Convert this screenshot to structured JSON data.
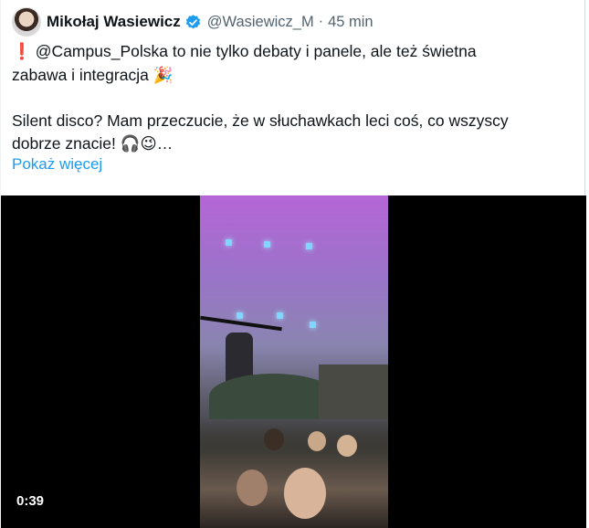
{
  "tweet": {
    "author_name": "Mikołaj Wasiewicz",
    "handle": "@Wasiewicz_M",
    "separator": "·",
    "time": "45 min",
    "line1_mention": "@Campus_Polska",
    "line1_rest": " to nie tylko debaty i panele, ale też świetna",
    "line2": "zabawa i integracja 🎉",
    "line3": "Silent disco? Mam przeczucie, że w słuchawkach leci coś, co wszyscy",
    "line4": "dobrze znacie! 🎧😉…",
    "show_more": "Pokaż więcej"
  },
  "video": {
    "duration": "0:39"
  },
  "colors": {
    "link": "#1d9bf0",
    "secondary": "#536471",
    "verified": "#1d9bf0"
  }
}
